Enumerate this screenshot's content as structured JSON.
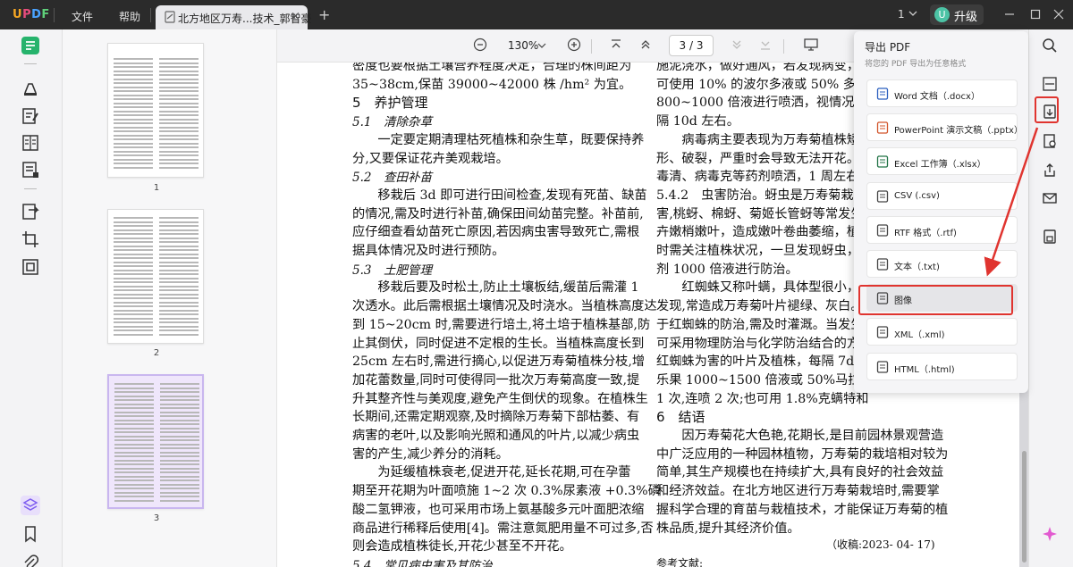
{
  "app": {
    "logo": "UPDF",
    "menu": [
      "文件",
      "帮助"
    ],
    "tab_title": "北方地区万寿...技术_郭智豪",
    "tab_close": "×",
    "tab_add": "+",
    "window_count": "1",
    "avatar_letter": "U",
    "upgrade_label": "升级"
  },
  "toolbar": {
    "zoom": "130%",
    "page_input": "3 / 3"
  },
  "thumbnails": [
    {
      "label": "1",
      "selected": false
    },
    {
      "label": "2",
      "selected": false
    },
    {
      "label": "3",
      "selected": true
    }
  ],
  "export_panel": {
    "title": "导出 PDF",
    "subtitle": "将您的 PDF 导出为任意格式",
    "items": [
      {
        "label": "Word 文档（.docx）",
        "icon": "word-icon",
        "highlighted": false
      },
      {
        "label": "PowerPoint 演示文稿（.pptx）",
        "icon": "powerpoint-icon",
        "highlighted": false
      },
      {
        "label": "Excel 工作簿（.xlsx）",
        "icon": "excel-icon",
        "highlighted": false
      },
      {
        "label": "CSV (.csv)",
        "icon": "csv-icon",
        "highlighted": false
      },
      {
        "label": "RTF 格式（.rtf)",
        "icon": "rtf-icon",
        "highlighted": false
      },
      {
        "label": "文本（.txt)",
        "icon": "text-icon",
        "highlighted": false
      },
      {
        "label": "图像",
        "icon": "image-icon",
        "highlighted": true
      },
      {
        "label": "XML（.xml)",
        "icon": "xml-icon",
        "highlighted": false
      },
      {
        "label": "HTML（.html)",
        "icon": "html-icon",
        "highlighted": false
      }
    ]
  },
  "document": {
    "left_column": [
      {
        "text": "密度也要根据土壤营养程度决定，合理的株间距为",
        "cls": "p"
      },
      {
        "text": "35~38cm,保苗 39000~42000 株 /hm² 为宜。",
        "cls": "p"
      },
      {
        "text": "5　养护管理",
        "cls": "p h1"
      },
      {
        "text": "5.1　清除杂草",
        "cls": "p h2"
      },
      {
        "text": "　　一定要定期清理枯死植株和杂生草，既要保持养",
        "cls": "p"
      },
      {
        "text": "分,又要保证花卉美观栽培。",
        "cls": "p"
      },
      {
        "text": "5.2　查田补苗",
        "cls": "p h2"
      },
      {
        "text": "　　移栽后 3d 即可进行田间检查,发现有死苗、缺苗",
        "cls": "p"
      },
      {
        "text": "的情况,需及时进行补苗,确保田间幼苗完整。补苗前,",
        "cls": "p"
      },
      {
        "text": "应仔细查看幼苗死亡原因,若因病虫害导致死亡,需根",
        "cls": "p"
      },
      {
        "text": "据具体情况及时进行预防。",
        "cls": "p"
      },
      {
        "text": "5.3　土肥管理",
        "cls": "p h2"
      },
      {
        "text": "　　移栽后要及时松土,防止土壤板结,缓苗后需灌 1",
        "cls": "p"
      },
      {
        "text": "次透水。此后需根据土壤情况及时浇水。当植株高度达",
        "cls": "p"
      },
      {
        "text": "到 15~20cm 时,需要进行培土,将土培于植株基部,防",
        "cls": "p"
      },
      {
        "text": "止其倒伏，同时促进不定根的生长。当植株高度长到",
        "cls": "p"
      },
      {
        "text": "25cm 左右时,需进行摘心,以促进万寿菊植株分枝,增",
        "cls": "p"
      },
      {
        "text": "加花蕾数量,同时可使得同一批次万寿菊高度一致,提",
        "cls": "p"
      },
      {
        "text": "升其整齐性与美观度,避免产生倒伏的现象。在植株生",
        "cls": "p"
      },
      {
        "text": "长期间,还需定期观察,及时摘除万寿菊下部枯萎、有",
        "cls": "p"
      },
      {
        "text": "病害的老叶,以及影响光照和通风的叶片,以减少病虫",
        "cls": "p"
      },
      {
        "text": "害的产生,减少养分的消耗。",
        "cls": "p"
      },
      {
        "text": "　　为延缓植株衰老,促进开花,延长花期,可在孕蕾",
        "cls": "p"
      },
      {
        "text": "期至开花期为叶面喷施 1~2 次 0.3%尿素液 +0.3%磷",
        "cls": "p"
      },
      {
        "text": "酸二氢钾液，也可采用市场上氨基酸多元叶面肥浓缩",
        "cls": "p"
      },
      {
        "text": "商品进行稀释后使用[4]。需注意氮肥用量不可过多,否",
        "cls": "p"
      },
      {
        "text": "则会造成植株徒长,开花少甚至不开花。",
        "cls": "p"
      },
      {
        "text": "5.4　常见病虫害及其防治",
        "cls": "p h2"
      }
    ],
    "right_column": [
      {
        "text": "施泥浇水，做好通风，若发现病变，应及",
        "cls": "p"
      },
      {
        "text": "可使用 10% 的波尔多液或 50% 多菌",
        "cls": "p"
      },
      {
        "text": "800~1000 倍液进行喷洒，视情况喷洒",
        "cls": "p"
      },
      {
        "text": "隔 10d 左右。",
        "cls": "p"
      },
      {
        "text": "　　病毒病主要表现为万寿菊植株矮小",
        "cls": "p"
      },
      {
        "text": "形、破裂，严重时会导致无法开花。可",
        "cls": "p"
      },
      {
        "text": "毒清、病毒克等药剂喷洒，1 周左右喷 1",
        "cls": "p"
      },
      {
        "text": "5.4.2　虫害防治。蚜虫是万寿菊栽培过",
        "cls": "p"
      },
      {
        "text": "害,桃蚜、棉蚜、菊姬长管蚜等常发生于",
        "cls": "p"
      },
      {
        "text": "卉嫩梢嫩叶，造成嫩叶卷曲萎缩，植株",
        "cls": "p"
      },
      {
        "text": "时需关注植株状况，一旦发现蚜虫，宜",
        "cls": "p"
      },
      {
        "text": "剂 1000 倍液进行防治。",
        "cls": "p"
      },
      {
        "text": "　　红蜘蛛又称叶螨，具体型很小，不",
        "cls": "p"
      },
      {
        "text": "发现,常造成万寿菊叶片褪绿、灰白。",
        "cls": "p"
      },
      {
        "text": "于红蜘蛛的防治,需及时灌溉。当发生",
        "cls": "p"
      },
      {
        "text": "可采用物理防治与化学防治结合的方法",
        "cls": "p"
      },
      {
        "text": "红蜘蛛为害的叶片及植株，每隔 7d",
        "cls": "p"
      },
      {
        "text": "乐果 1000~1500 倍液或 50%马拉硫磷",
        "cls": "p"
      },
      {
        "text": "1 次,连喷 2 次;也可用 1.8%克螨特和",
        "cls": "p"
      },
      {
        "text": "6　结语",
        "cls": "p h1"
      },
      {
        "text": "　　因万寿菊花大色艳,花期长,是目前园林景观营造",
        "cls": "p"
      },
      {
        "text": "中广泛应用的一种园林植物，万寿菊的栽培相对较为",
        "cls": "p"
      },
      {
        "text": "简单,其生产规模也在持续扩大,具有良好的社会效益",
        "cls": "p"
      },
      {
        "text": "和经济效益。在北方地区进行万寿菊栽培时,需要掌",
        "cls": "p"
      },
      {
        "text": "握科学合理的育苗与栽植技术，才能保证万寿菊的植",
        "cls": "p"
      },
      {
        "text": "株品质,提升其经济价值。",
        "cls": "p"
      },
      {
        "text": "（收稿:2023- 04- 17)",
        "cls": "p small received"
      },
      {
        "text": "参考文献:",
        "cls": "p small refs"
      }
    ]
  },
  "colors": {
    "accent": "#7d5cf0",
    "highlight_red": "#e0342f",
    "titlebar": "#2b2b2b"
  }
}
